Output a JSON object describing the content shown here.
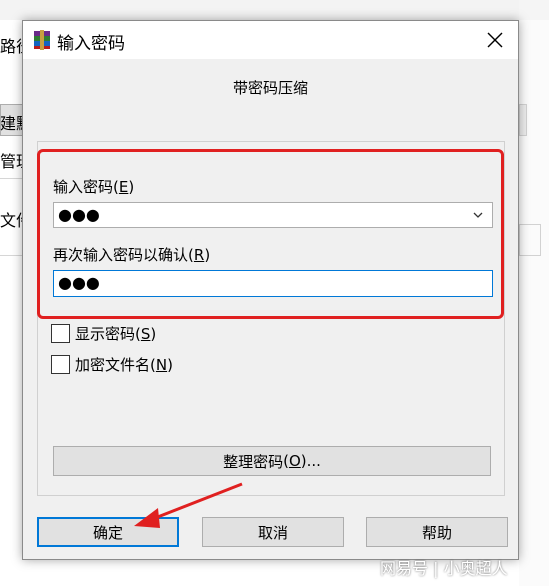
{
  "background": {
    "fragments": [
      "路径",
      "建默",
      "管理",
      "文件"
    ]
  },
  "dialog": {
    "title": "输入密码",
    "subtitle": "带密码压缩",
    "password_label": "输入密码",
    "password_key": "E",
    "password_value": "●●●",
    "confirm_label": "再次输入密码以确认",
    "confirm_key": "R",
    "confirm_value": "●●●",
    "show_password_label": "显示密码",
    "show_password_key": "S",
    "encrypt_names_label": "加密文件名",
    "encrypt_names_key": "N",
    "organize_button": "整理密码",
    "organize_key": "O",
    "organize_suffix": "...",
    "ok_button": "确定",
    "cancel_button": "取消",
    "help_button": "帮助"
  },
  "watermark": "网易号 | 小奥超人",
  "colors": {
    "highlight": "#e02020",
    "focus": "#0078d7",
    "button_bg": "#e1e1e1"
  }
}
